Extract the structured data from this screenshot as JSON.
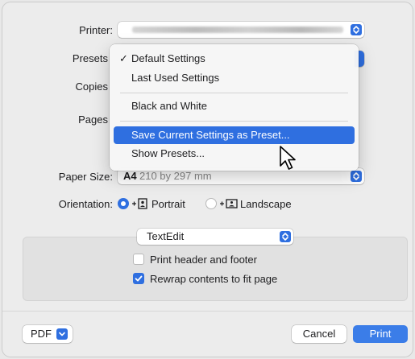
{
  "fields": {
    "printer_label": "Printer:",
    "presets_label": "Presets",
    "copies_label": "Copies",
    "pages_label": "Pages",
    "paper_size_label": "Paper Size:",
    "paper_size_value": "A4",
    "paper_size_dims": "210 by 297 mm",
    "orientation_label": "Orientation:",
    "orientation_portrait": "Portrait",
    "orientation_landscape": "Landscape",
    "orientation_selected": "Portrait"
  },
  "app_options": {
    "app_select_value": "TextEdit",
    "print_header_footer_label": "Print header and footer",
    "print_header_footer_checked": false,
    "rewrap_label": "Rewrap contents to fit page",
    "rewrap_checked": true
  },
  "presets_menu": {
    "items": [
      {
        "label": "Default Settings",
        "checked": true
      },
      {
        "label": "Last Used Settings",
        "checked": false
      },
      {
        "label": "Black and White",
        "checked": false
      },
      {
        "label": "Save Current Settings as Preset...",
        "highlighted": true
      },
      {
        "label": "Show Presets...",
        "highlighted": false
      }
    ]
  },
  "footer": {
    "pdf_label": "PDF",
    "cancel_label": "Cancel",
    "print_label": "Print"
  },
  "colors": {
    "accent": "#2f6fe0",
    "dialog_bg": "#ececec"
  }
}
